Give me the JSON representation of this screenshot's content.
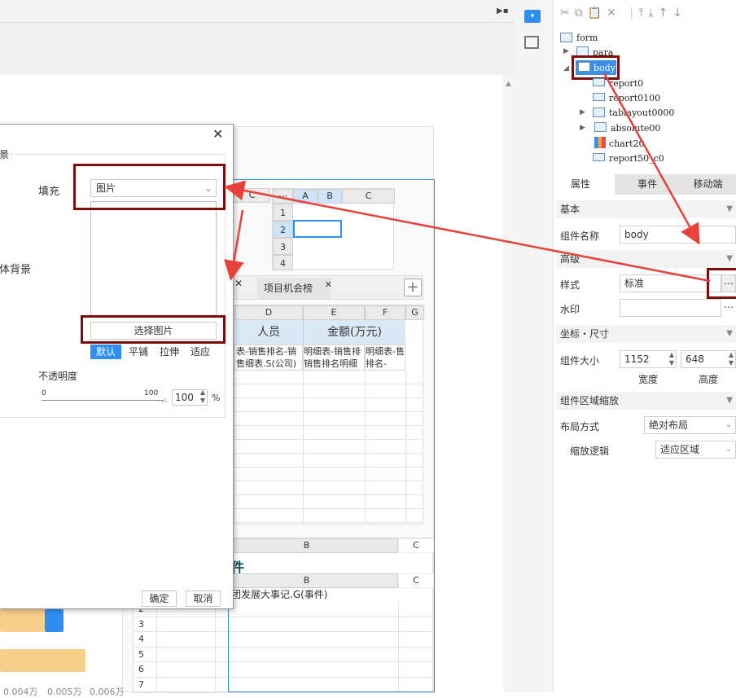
{
  "dialog": {
    "close_icon": "close-icon",
    "section_label": "景",
    "fill_label": "填充",
    "fill_value": "图片",
    "body_bg_label": "体背景",
    "choose_image_button": "选择图片",
    "modes": [
      "默认",
      "平铺",
      "拉伸",
      "适应"
    ],
    "opacity_label": "不透明度",
    "slider_min": "0",
    "slider_max": "100",
    "opacity_value": "100",
    "opacity_unit": "%",
    "ok_button": "确定",
    "cancel_button": "取消"
  },
  "canvas": {
    "mini_grid": {
      "cols": [
        "A",
        "B",
        "C"
      ],
      "rows": [
        "1",
        "2",
        "3",
        "4"
      ],
      "corner": "⋯"
    },
    "left_col_c": "C",
    "tab_project": "项目机会榜",
    "add_tab_icon": "plus-icon",
    "table": {
      "col_d": "D",
      "col_e": "E",
      "col_f": "F",
      "col_g": "G",
      "header_people": "人员",
      "header_amount": "金额(万元)",
      "row1_d": "表-销售排名-销售细表.S(公司)",
      "row1_e": "明细表-销售排销售排名明细",
      "row1_f": "明细表-售排名-"
    },
    "lower_grid": {
      "col_b1": "B",
      "col_c1": "C",
      "title_fragment": "件",
      "col_b2": "B",
      "col_c2": "C",
      "row1_text": "团发展大事记.G(事件)",
      "rows": [
        "2",
        "3",
        "4",
        "5",
        "6",
        "7"
      ]
    },
    "axis_labels": [
      "0.004万",
      "0.005万",
      "0.006万"
    ]
  },
  "tree": {
    "items": [
      {
        "label": "form"
      },
      {
        "label": "para"
      },
      {
        "label": "body"
      },
      {
        "label": "report0"
      },
      {
        "label": "report0100"
      },
      {
        "label": "tablayout0000"
      },
      {
        "label": "absolute00"
      },
      {
        "label": "chart20"
      },
      {
        "label": "report50_c0"
      }
    ]
  },
  "right_panel": {
    "tabs": [
      "属性",
      "事件",
      "移动端"
    ],
    "basic_section": "基本",
    "component_name_label": "组件名称",
    "component_name_value": "body",
    "advanced_section": "高级",
    "style_label": "样式",
    "style_value": "标准",
    "more_button": "⋯",
    "watermark_label": "水印",
    "watermark_value": "",
    "coord_section": "坐标・尺寸",
    "size_label": "组件大小",
    "width_value": "1152",
    "height_value": "648",
    "width_caption": "宽度",
    "height_caption": "高度",
    "scale_section": "组件区域缩放",
    "layout_label": "布局方式",
    "layout_value": "绝对布局",
    "scale_logic_label": "缩放逻辑",
    "scale_logic_value": "适应区域"
  },
  "colors": {
    "highlight": "#7b0d0d",
    "arrow": "#e8403a",
    "selection_blue": "#3b8de0",
    "bar_orange": "#f7cf8a",
    "bar_blue": "#2f8ff0"
  }
}
